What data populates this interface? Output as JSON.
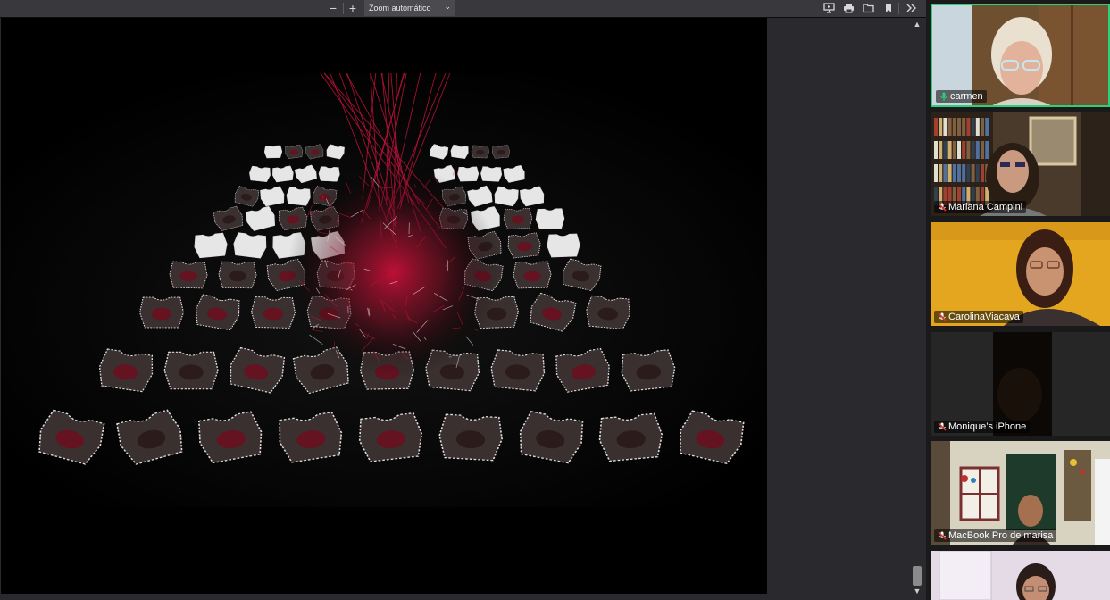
{
  "toolbar": {
    "zoom_out": "−",
    "zoom_in": "+",
    "zoom_label": "Zoom automático",
    "icons": [
      "presentation-icon",
      "print-icon",
      "open-file-icon",
      "bookmark-icon",
      "tools-chevron-icon"
    ]
  },
  "viewer": {
    "scroll_up": "▲",
    "scroll_down": "▼"
  },
  "participants": [
    {
      "name": "carmen",
      "muted": false,
      "active": true,
      "bg": "#7a5c3a"
    },
    {
      "name": "Mariana Campini",
      "muted": true,
      "active": false,
      "bg": "#3d2f24"
    },
    {
      "name": "CarolinaViacava",
      "muted": true,
      "active": false,
      "bg": "#e3a61e"
    },
    {
      "name": "Monique’s iPhone",
      "muted": true,
      "active": false,
      "bg": "#2a2a2a"
    },
    {
      "name": "MacBook Pro de marisa",
      "muted": true,
      "active": false,
      "bg": "#4b4a3e"
    },
    {
      "name": "",
      "muted": true,
      "active": false,
      "bg": "#e4dbe6"
    }
  ],
  "colors": {
    "active_border": "#2bd17a",
    "mic_on": "#2bd17a",
    "mic_off": "#e0302a",
    "thread_red": "#c0123a"
  }
}
